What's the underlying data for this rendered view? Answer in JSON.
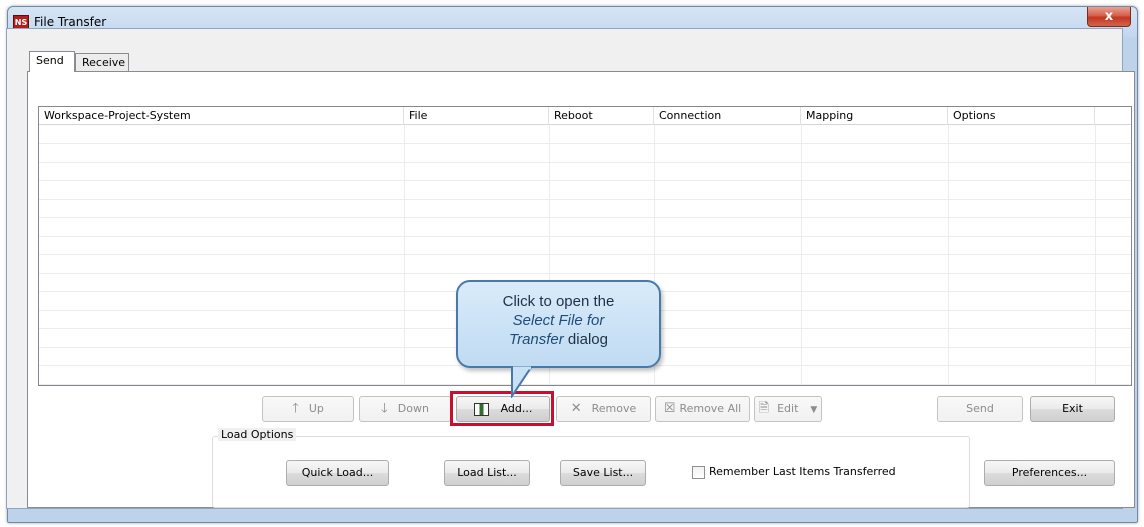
{
  "window": {
    "title": "File Transfer",
    "app_icon_text": "NS",
    "close_glyph": "x"
  },
  "tabs": [
    {
      "label": "Send"
    },
    {
      "label": "Receive"
    }
  ],
  "grid": {
    "columns": [
      "Workspace-Project-System",
      "File",
      "Reboot",
      "Connection",
      "Mapping",
      "Options"
    ]
  },
  "buttons": {
    "up": {
      "label": "Up",
      "icon": "arrow-up-icon"
    },
    "down": {
      "label": "Down",
      "icon": "arrow-down-icon"
    },
    "add": {
      "label": "Add...",
      "icon": "add-file-icon"
    },
    "remove": {
      "label": "Remove",
      "icon": "x-icon"
    },
    "remove_all": {
      "label": "Remove All",
      "icon": "x-box-icon"
    },
    "edit": {
      "label": "Edit",
      "icon": "edit-icon"
    },
    "send": {
      "label": "Send"
    },
    "exit": {
      "label": "Exit"
    }
  },
  "load_options": {
    "label": "Load Options",
    "quick_load": "Quick Load...",
    "load_list": "Load List...",
    "save_list": "Save List...",
    "remember_label": "Remember Last Items Transferred",
    "remember_checked": false,
    "preferences": "Preferences..."
  },
  "callout": {
    "line1": "Click to open the",
    "line2": "Select File for",
    "line3_em": "Transfer",
    "line3_rest": " dialog"
  },
  "colors": {
    "highlight": "#c8102e",
    "callout_border": "#4979aa",
    "close_red": "#c2361f"
  }
}
